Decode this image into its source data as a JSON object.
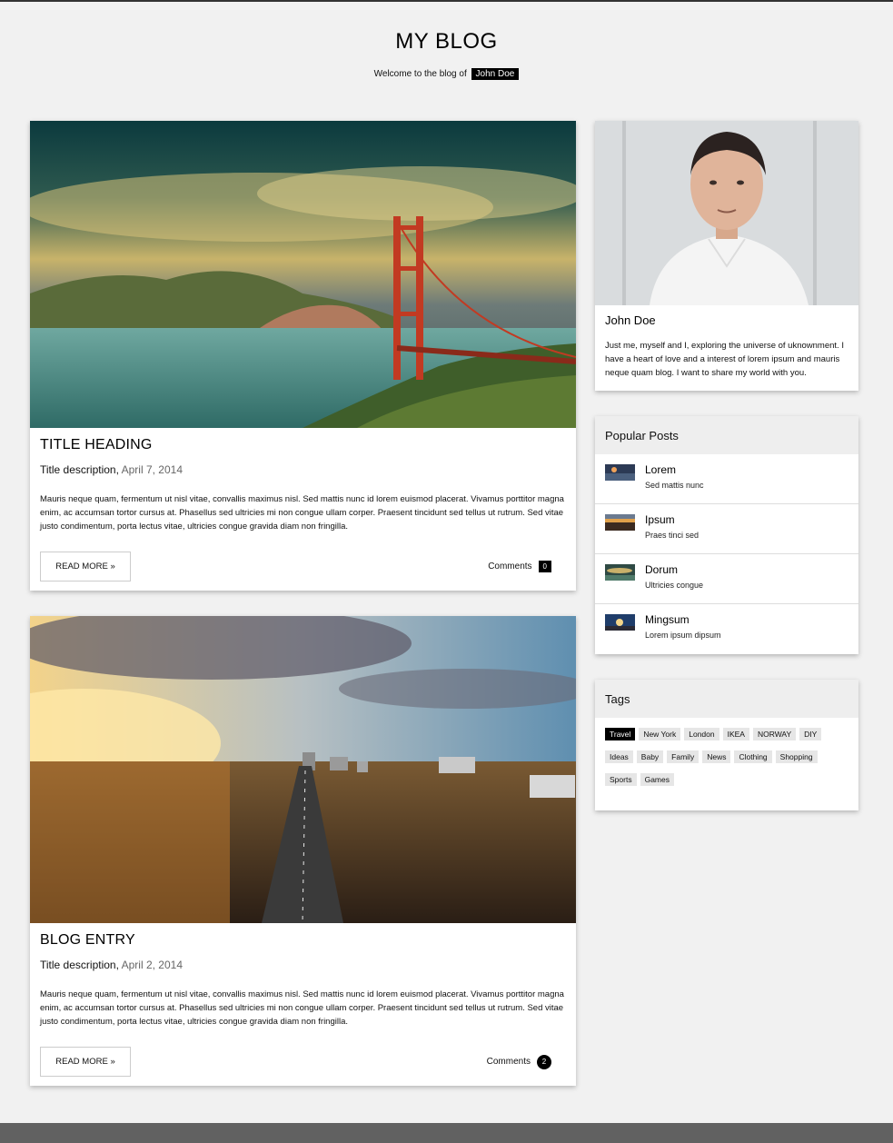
{
  "header": {
    "title": "MY BLOG",
    "welcome_text": "Welcome to the blog of",
    "author_tag": "John Doe"
  },
  "posts": [
    {
      "title": "TITLE HEADING",
      "description": "Title description,",
      "date": "April 7, 2014",
      "body": "Mauris neque quam, fermentum ut nisl vitae, convallis maximus nisl. Sed mattis nunc id lorem euismod placerat. Vivamus porttitor magna enim, ac accumsan tortor cursus at. Phasellus sed ultricies mi non congue ullam corper. Praesent tincidunt sed tellus ut rutrum. Sed vitae justo condimentum, porta lectus vitae, ultricies congue gravida diam non fringilla.",
      "read_more": "READ MORE »",
      "comments_label": "Comments",
      "comments_count": "0"
    },
    {
      "title": "BLOG ENTRY",
      "description": "Title description,",
      "date": "April 2, 2014",
      "body": "Mauris neque quam, fermentum ut nisl vitae, convallis maximus nisl. Sed mattis nunc id lorem euismod placerat. Vivamus porttitor magna enim, ac accumsan tortor cursus at. Phasellus sed ultricies mi non congue ullam corper. Praesent tincidunt sed tellus ut rutrum. Sed vitae justo condimentum, porta lectus vitae, ultricies congue gravida diam non fringilla.",
      "read_more": "READ MORE »",
      "comments_label": "Comments",
      "comments_count": "2"
    }
  ],
  "profile": {
    "name": "John Doe",
    "bio": "Just me, myself and I, exploring the universe of uknownment. I have a heart of love and a interest of lorem ipsum and mauris neque quam blog. I want to share my world with you."
  },
  "popular": {
    "heading": "Popular Posts",
    "items": [
      {
        "title": "Lorem",
        "subtitle": "Sed mattis nunc"
      },
      {
        "title": "Ipsum",
        "subtitle": "Praes tinci sed"
      },
      {
        "title": "Dorum",
        "subtitle": "Ultricies congue"
      },
      {
        "title": "Mingsum",
        "subtitle": "Lorem ipsum dipsum"
      }
    ]
  },
  "tags": {
    "heading": "Tags",
    "items": [
      "Travel",
      "New York",
      "London",
      "IKEA",
      "NORWAY",
      "DIY",
      "Ideas",
      "Baby",
      "Family",
      "News",
      "Clothing",
      "Shopping",
      "Sports",
      "Games"
    ],
    "active": "Travel"
  }
}
